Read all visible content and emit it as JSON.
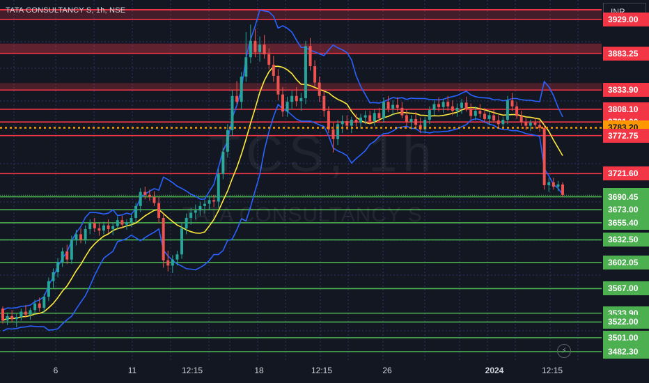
{
  "header": {
    "symbol_line": "TATA CONSULTANCY S, 1h, NSE"
  },
  "watermark": {
    "big": "TCS, 1h",
    "small": "TATA CONSULTANCY S"
  },
  "currency": "INR",
  "icons": {
    "bolt": "lightning-bolt-icon"
  },
  "colors": {
    "background": "#131722",
    "up_candle": "#26a69a",
    "down_candle": "#ef5350",
    "resistance_line": "#f23645",
    "support_line": "#4caf50",
    "band_line": "#2962ff",
    "mid_line": "#ffeb3b",
    "current_price_line": "#ff9800",
    "grid": "#2a3a6a"
  },
  "chart_data": {
    "type": "candlestick",
    "title": "TATA CONSULTANCY S, 1h, NSE",
    "currency": "INR",
    "y_range": [
      3470,
      3955
    ],
    "grid": true,
    "x_tick_labels": [
      "6",
      "11",
      "12:15",
      "18",
      "12:15",
      "26",
      "2024",
      "12:15"
    ],
    "current_price": 3783.2,
    "last_price": 3692.6,
    "resistance_levels": [
      3929.0,
      3883.25,
      3833.9,
      3808.1,
      3791.0,
      3772.75,
      3721.6
    ],
    "support_levels": [
      3690.45,
      3673.0,
      3655.4,
      3632.5,
      3602.05,
      3567.0,
      3533.9,
      3522.0,
      3501.0,
      3482.3
    ],
    "price_labels": [
      "3929.00",
      "3883.25",
      "3833.90",
      "3808.10",
      "3791.00",
      "3783.20",
      "3772.75",
      "3721.60",
      "3692.60",
      "3690.45",
      "3673.00",
      "3655.40",
      "3632.50",
      "3602.05",
      "3567.00",
      "3533.90",
      "3522.00",
      "3501.00",
      "3482.30"
    ],
    "candles": [
      [
        3540,
        3543,
        3520,
        3524
      ],
      [
        3524,
        3535,
        3518,
        3530
      ],
      [
        3530,
        3538,
        3522,
        3526
      ],
      [
        3526,
        3533,
        3515,
        3529
      ],
      [
        3529,
        3540,
        3524,
        3536
      ],
      [
        3536,
        3545,
        3528,
        3532
      ],
      [
        3532,
        3541,
        3525,
        3538
      ],
      [
        3538,
        3552,
        3532,
        3547
      ],
      [
        3547,
        3555,
        3536,
        3541
      ],
      [
        3541,
        3560,
        3535,
        3556
      ],
      [
        3556,
        3582,
        3550,
        3577
      ],
      [
        3577,
        3594,
        3568,
        3589
      ],
      [
        3589,
        3608,
        3582,
        3603
      ],
      [
        3603,
        3622,
        3596,
        3617
      ],
      [
        3617,
        3626,
        3600,
        3606
      ],
      [
        3606,
        3638,
        3600,
        3632
      ],
      [
        3632,
        3646,
        3625,
        3640
      ],
      [
        3640,
        3648,
        3628,
        3633
      ],
      [
        3633,
        3652,
        3627,
        3647
      ],
      [
        3647,
        3660,
        3640,
        3655
      ],
      [
        3655,
        3662,
        3643,
        3648
      ],
      [
        3648,
        3655,
        3638,
        3645
      ],
      [
        3645,
        3657,
        3640,
        3652
      ],
      [
        3652,
        3660,
        3642,
        3647
      ],
      [
        3647,
        3656,
        3639,
        3651
      ],
      [
        3651,
        3664,
        3646,
        3659
      ],
      [
        3659,
        3665,
        3648,
        3653
      ],
      [
        3653,
        3660,
        3646,
        3656
      ],
      [
        3656,
        3667,
        3650,
        3662
      ],
      [
        3662,
        3682,
        3656,
        3678
      ],
      [
        3678,
        3702,
        3670,
        3697
      ],
      [
        3697,
        3704,
        3687,
        3693
      ],
      [
        3693,
        3700,
        3685,
        3690
      ],
      [
        3690,
        3698,
        3678,
        3682
      ],
      [
        3682,
        3690,
        3655,
        3662
      ],
      [
        3662,
        3668,
        3595,
        3605
      ],
      [
        3605,
        3618,
        3590,
        3598
      ],
      [
        3598,
        3612,
        3588,
        3606
      ],
      [
        3606,
        3618,
        3598,
        3613
      ],
      [
        3613,
        3655,
        3607,
        3648
      ],
      [
        3648,
        3668,
        3640,
        3662
      ],
      [
        3662,
        3675,
        3653,
        3669
      ],
      [
        3669,
        3680,
        3660,
        3672
      ],
      [
        3672,
        3684,
        3665,
        3678
      ],
      [
        3678,
        3686,
        3668,
        3681
      ],
      [
        3681,
        3691,
        3672,
        3686
      ],
      [
        3686,
        3693,
        3677,
        3684
      ],
      [
        3684,
        3728,
        3676,
        3721
      ],
      [
        3721,
        3756,
        3714,
        3751
      ],
      [
        3751,
        3788,
        3743,
        3780
      ],
      [
        3780,
        3834,
        3772,
        3826
      ],
      [
        3826,
        3846,
        3815,
        3818
      ],
      [
        3818,
        3858,
        3808,
        3852
      ],
      [
        3852,
        3912,
        3845,
        3878
      ],
      [
        3878,
        3922,
        3870,
        3900
      ],
      [
        3900,
        3916,
        3878,
        3885
      ],
      [
        3885,
        3906,
        3872,
        3895
      ],
      [
        3895,
        3908,
        3876,
        3882
      ],
      [
        3882,
        3890,
        3862,
        3868
      ],
      [
        3868,
        3880,
        3845,
        3853
      ],
      [
        3853,
        3862,
        3820,
        3828
      ],
      [
        3828,
        3838,
        3798,
        3805
      ],
      [
        3805,
        3825,
        3798,
        3818
      ],
      [
        3818,
        3833,
        3808,
        3826
      ],
      [
        3826,
        3838,
        3812,
        3819
      ],
      [
        3819,
        3830,
        3806,
        3823
      ],
      [
        3823,
        3900,
        3815,
        3893
      ],
      [
        3893,
        3904,
        3860,
        3866
      ],
      [
        3866,
        3874,
        3838,
        3844
      ],
      [
        3844,
        3852,
        3818,
        3826
      ],
      [
        3826,
        3834,
        3798,
        3806
      ],
      [
        3806,
        3812,
        3776,
        3781
      ],
      [
        3781,
        3790,
        3750,
        3768
      ],
      [
        3768,
        3794,
        3760,
        3788
      ],
      [
        3788,
        3800,
        3776,
        3792
      ],
      [
        3792,
        3800,
        3780,
        3786
      ],
      [
        3786,
        3798,
        3776,
        3794
      ],
      [
        3794,
        3802,
        3785,
        3790
      ],
      [
        3790,
        3802,
        3782,
        3797
      ],
      [
        3797,
        3806,
        3788,
        3800
      ],
      [
        3800,
        3806,
        3788,
        3792
      ],
      [
        3792,
        3808,
        3786,
        3803
      ],
      [
        3803,
        3810,
        3792,
        3796
      ],
      [
        3796,
        3824,
        3790,
        3818
      ],
      [
        3818,
        3826,
        3804,
        3809
      ],
      [
        3809,
        3820,
        3800,
        3814
      ],
      [
        3814,
        3824,
        3805,
        3810
      ],
      [
        3810,
        3818,
        3796,
        3800
      ],
      [
        3800,
        3808,
        3786,
        3791
      ],
      [
        3791,
        3800,
        3781,
        3795
      ],
      [
        3795,
        3804,
        3784,
        3787
      ],
      [
        3787,
        3797,
        3776,
        3781
      ],
      [
        3781,
        3798,
        3776,
        3794
      ],
      [
        3794,
        3812,
        3788,
        3807
      ],
      [
        3807,
        3820,
        3800,
        3815
      ],
      [
        3815,
        3824,
        3805,
        3811
      ],
      [
        3811,
        3822,
        3803,
        3818
      ],
      [
        3818,
        3826,
        3806,
        3812
      ],
      [
        3812,
        3820,
        3800,
        3806
      ],
      [
        3806,
        3816,
        3798,
        3810
      ],
      [
        3810,
        3822,
        3802,
        3817
      ],
      [
        3817,
        3825,
        3805,
        3808
      ],
      [
        3808,
        3816,
        3794,
        3799
      ],
      [
        3799,
        3812,
        3793,
        3806
      ],
      [
        3806,
        3815,
        3797,
        3802
      ],
      [
        3802,
        3810,
        3790,
        3795
      ],
      [
        3795,
        3805,
        3787,
        3800
      ],
      [
        3800,
        3808,
        3790,
        3793
      ],
      [
        3793,
        3800,
        3782,
        3788
      ],
      [
        3788,
        3798,
        3782,
        3794
      ],
      [
        3794,
        3826,
        3788,
        3820
      ],
      [
        3820,
        3830,
        3806,
        3812
      ],
      [
        3812,
        3818,
        3795,
        3799
      ],
      [
        3799,
        3806,
        3786,
        3791
      ],
      [
        3791,
        3796,
        3780,
        3786
      ],
      [
        3786,
        3794,
        3779,
        3790
      ],
      [
        3790,
        3796,
        3782,
        3787
      ],
      [
        3787,
        3793,
        3778,
        3783
      ],
      [
        3783,
        3788,
        3700,
        3706
      ],
      [
        3706,
        3716,
        3697,
        3710
      ],
      [
        3710,
        3716,
        3700,
        3704
      ],
      [
        3704,
        3712,
        3698,
        3707
      ],
      [
        3707,
        3710,
        3690,
        3693
      ]
    ]
  }
}
